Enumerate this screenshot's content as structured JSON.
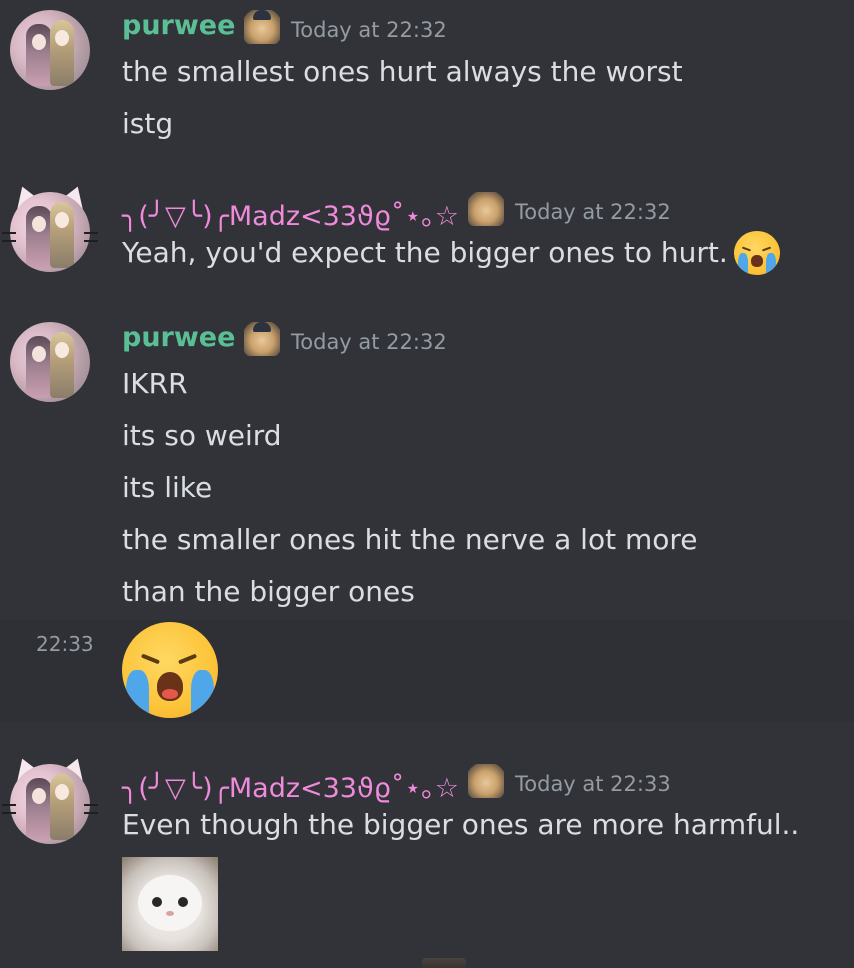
{
  "messages": [
    {
      "username": "purwee",
      "timestamp": "Today at 22:32",
      "lines": [
        "the smallest ones hurt always the worst",
        "istg"
      ]
    },
    {
      "username": "╮(╯▽╰)╭Madz<33ϑϱ˚⋆｡☆",
      "timestamp": "Today at 22:32",
      "lines": [
        "Yeah, you'd expect the bigger ones to hurt."
      ]
    },
    {
      "username": "purwee",
      "timestamp": "Today at 22:32",
      "lines": [
        "IKRR",
        "its so weird",
        "its like",
        "the smaller ones hit the nerve a lot more",
        "than the bigger ones"
      ]
    },
    {
      "hover_timestamp": "22:33",
      "emoji": "loudly-crying-face"
    },
    {
      "username": "╮(╯▽╰)╭Madz<33ϑϱ˚⋆｡☆",
      "timestamp": "Today at 22:33",
      "lines": [
        "Even though the bigger ones are more harmful.."
      ],
      "attachment": "sad-white-cat-image"
    }
  ],
  "colors": {
    "background": "#313338",
    "text": "#dbdee1",
    "muted": "#949ba4",
    "purwee_name": "#5bbf95",
    "madz_name": "#f08adb"
  }
}
